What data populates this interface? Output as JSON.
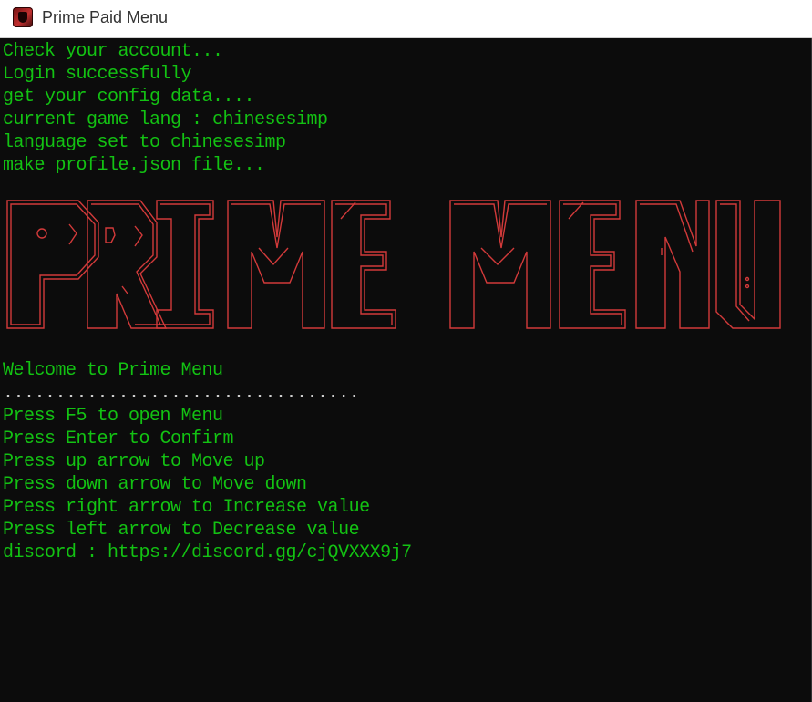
{
  "window": {
    "title": "Prime Paid Menu",
    "icon": "app-icon"
  },
  "console": {
    "text_color": "#13c213",
    "background": "#0c0c0c",
    "status_lines": [
      "Check your account...",
      "Login successfully",
      "get your config data....",
      "current game lang : chinesesimp",
      "language set to chinesesimp",
      "make profile.json file..."
    ],
    "banner": {
      "text": "PRIME MENU",
      "color": "#d23a3a"
    },
    "welcome": "Welcome to Prime Menu",
    "separator": "..................................",
    "instructions": [
      "Press F5 to open Menu",
      "Press Enter to Confirm",
      "Press up arrow to Move up",
      "Press down arrow to Move down",
      "Press right arrow to Increase value",
      "Press left arrow to Decrease value",
      "discord : https://discord.gg/cjQVXXX9j7"
    ]
  }
}
